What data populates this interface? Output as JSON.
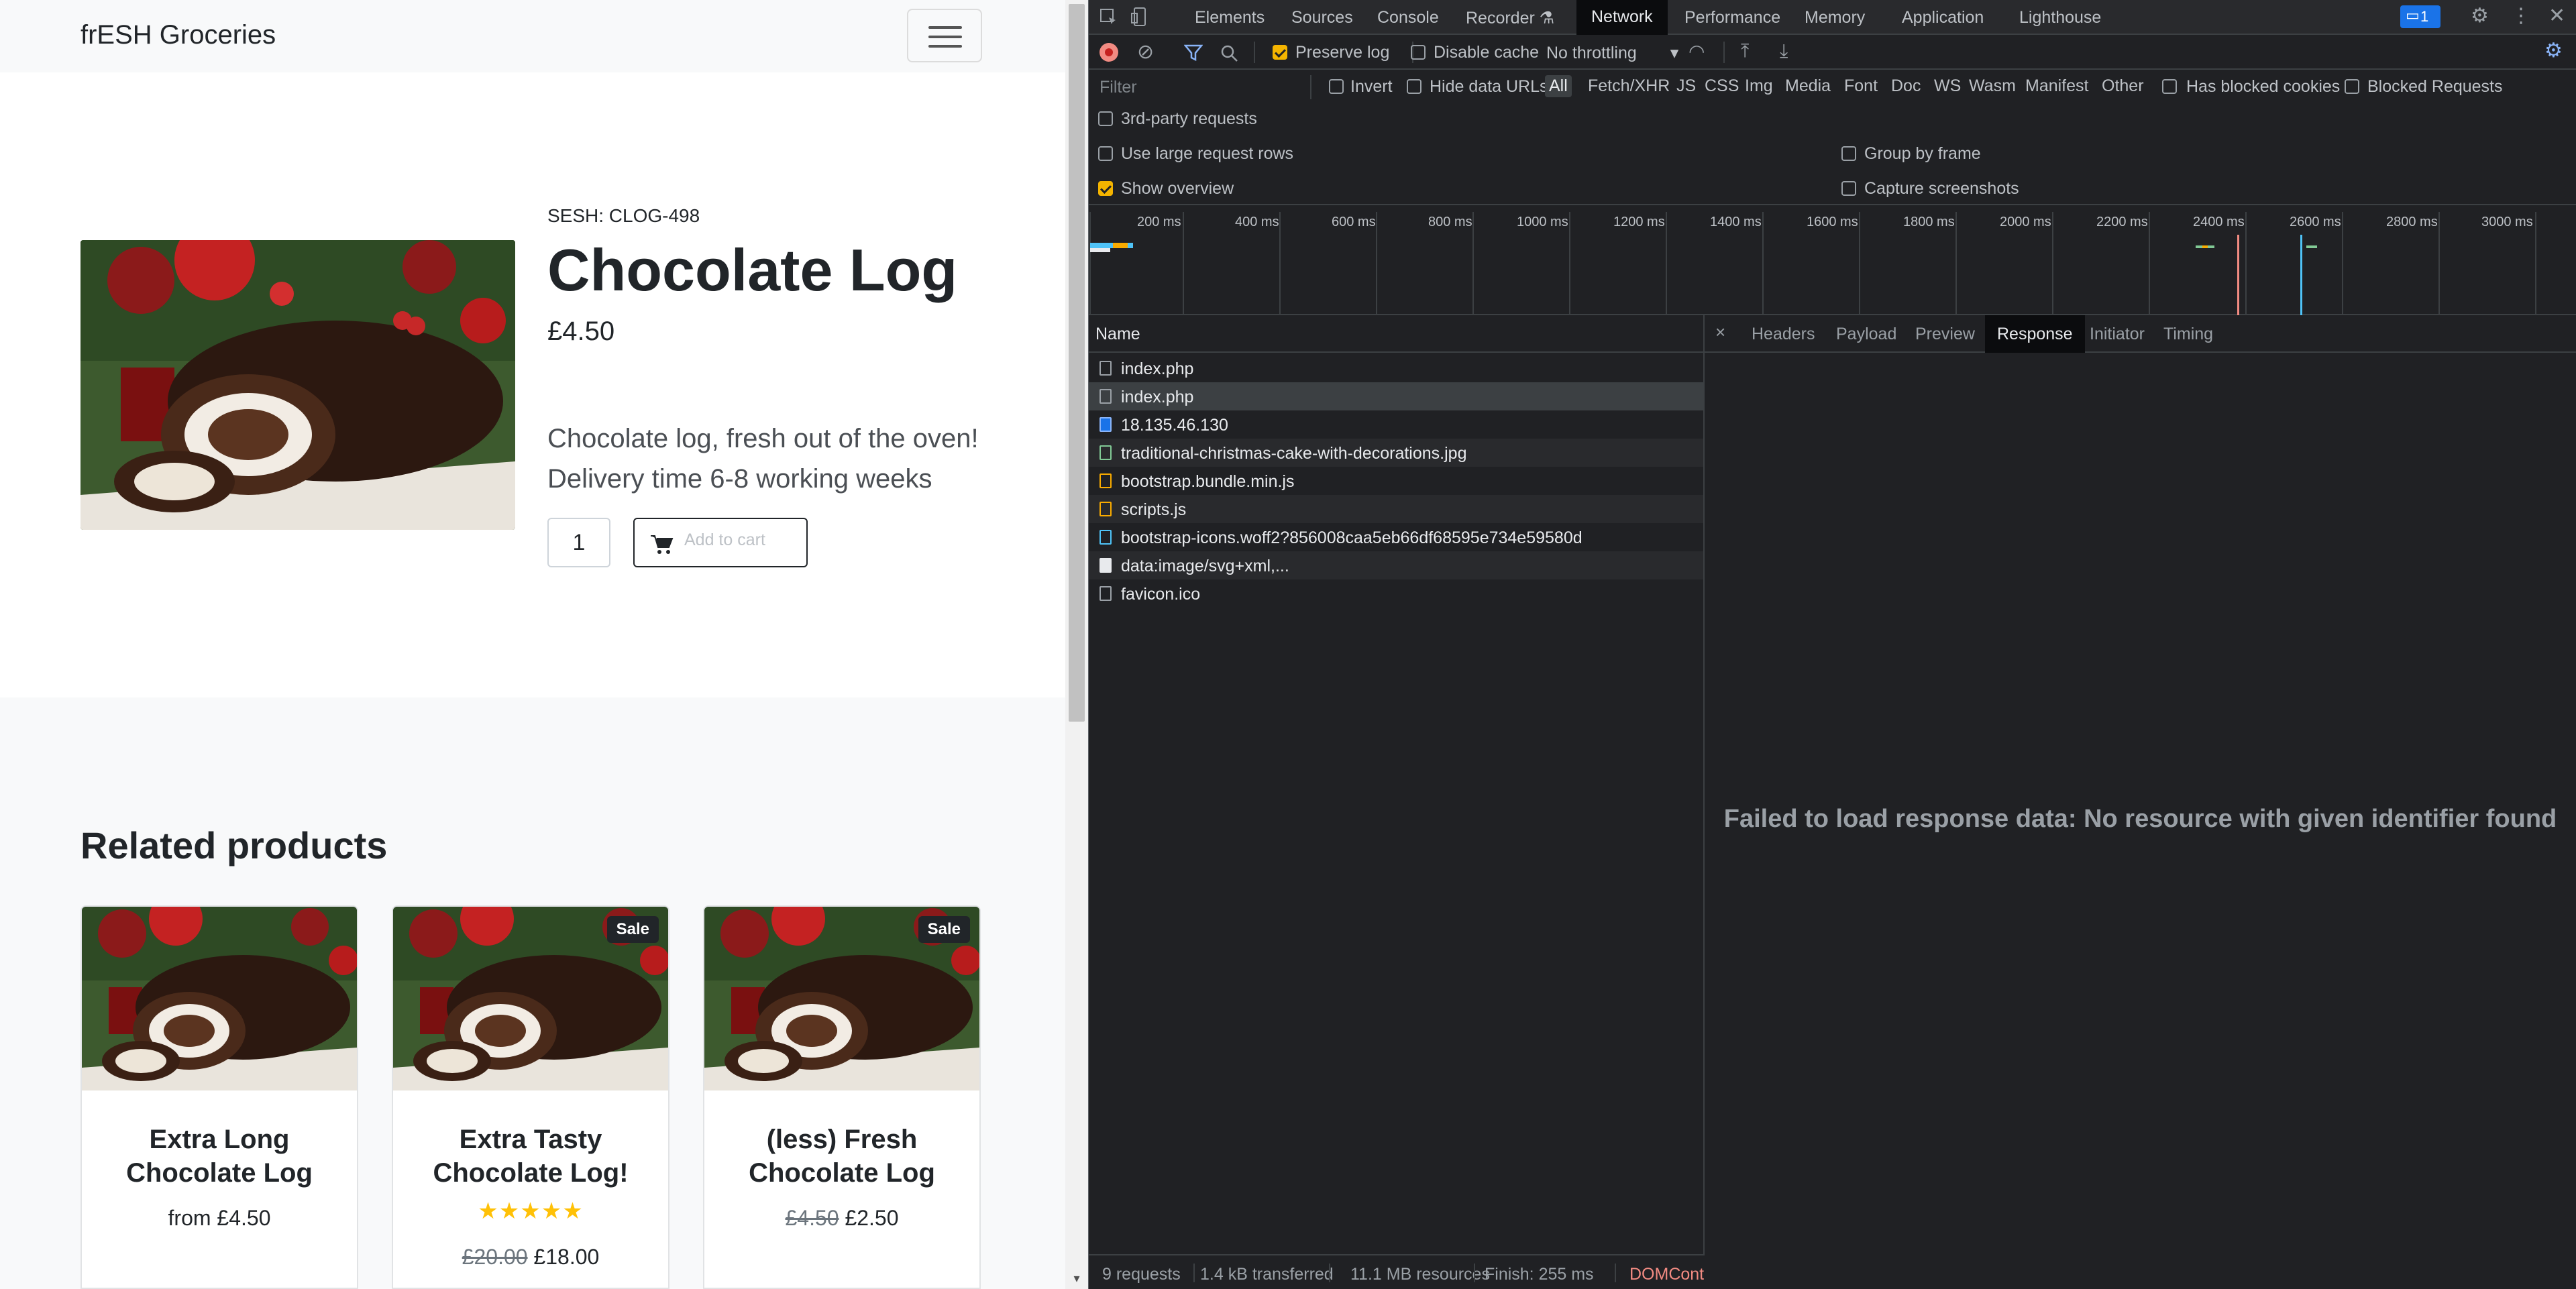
{
  "shop": {
    "brand": "frESH Groceries",
    "product": {
      "sku": "SESH: CLOG-498",
      "title": "Chocolate Log",
      "price": "£4.50",
      "description_1": "Chocolate log, fresh out of the oven!",
      "description_2": "Delivery time 6-8 working weeks",
      "quantity": "1",
      "add_to_cart": "Add to cart"
    },
    "related_heading": "Related products",
    "related": [
      {
        "title": "Extra Long Chocolate Log",
        "price_prefix": "from",
        "price": "£4.50",
        "badge": "",
        "old_price": "",
        "rating": 0
      },
      {
        "title": "Extra Tasty Chocolate Log!",
        "price_prefix": "",
        "price": "£18.00",
        "badge": "Sale",
        "old_price": "£20.00",
        "rating": 5
      },
      {
        "title": "(less) Fresh Chocolate Log",
        "price_prefix": "",
        "price": "£2.50",
        "badge": "Sale",
        "old_price": "£4.50",
        "rating": 0
      }
    ]
  },
  "devtools": {
    "tabs": [
      "Elements",
      "Sources",
      "Console",
      "Recorder",
      "Network",
      "Performance",
      "Memory",
      "Application",
      "Lighthouse"
    ],
    "active_tab": "Network",
    "issues_count": "1",
    "toolbar": {
      "preserve_log": "Preserve log",
      "disable_cache": "Disable cache",
      "throttling": "No throttling"
    },
    "filter": {
      "placeholder": "Filter",
      "invert": "Invert",
      "hide_data_urls": "Hide data URLs",
      "types": [
        "All",
        "Fetch/XHR",
        "JS",
        "CSS",
        "Img",
        "Media",
        "Font",
        "Doc",
        "WS",
        "Wasm",
        "Manifest",
        "Other"
      ],
      "has_blocked_cookies": "Has blocked cookies",
      "blocked_requests": "Blocked Requests",
      "third_party": "3rd-party requests"
    },
    "settings": {
      "large_rows": "Use large request rows",
      "show_overview": "Show overview",
      "group_by_frame": "Group by frame",
      "capture_screenshots": "Capture screenshots"
    },
    "timeline_ticks": [
      "200 ms",
      "400 ms",
      "600 ms",
      "800 ms",
      "1000 ms",
      "1200 ms",
      "1400 ms",
      "1600 ms",
      "1800 ms",
      "2000 ms",
      "2200 ms",
      "2400 ms",
      "2600 ms",
      "2800 ms",
      "3000 ms"
    ],
    "name_column": "Name",
    "requests": [
      "index.php",
      "index.php",
      "18.135.46.130",
      "traditional-christmas-cake-with-decorations.jpg",
      "bootstrap.bundle.min.js",
      "scripts.js",
      "bootstrap-icons.woff2?856008caa5eb66df68595e734e59580d",
      "data:image/svg+xml,...",
      "favicon.ico"
    ],
    "detail_tabs": [
      "Headers",
      "Payload",
      "Preview",
      "Response",
      "Initiator",
      "Timing"
    ],
    "active_detail_tab": "Response",
    "empty_message": "Failed to load response data: No resource with given identifier found",
    "status": {
      "requests": "9 requests",
      "transferred": "1.4 kB transferred",
      "resources": "11.1 MB resources",
      "finish": "Finish: 255 ms",
      "domcontent": "DOMCont"
    }
  }
}
